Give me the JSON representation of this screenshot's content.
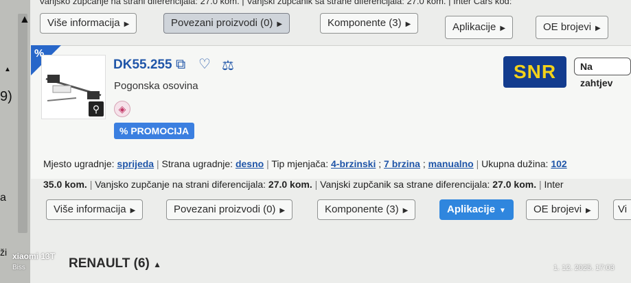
{
  "top_info": "Vanjsko zupčanje na strani diferencijala: 27.0 kom. | Vanjski zupčanik sa strane diferencijala: 27.0 kom. | Inter Cars kod:",
  "buttons_top": [
    "Više informacija",
    "Povezani proizvodi (0)",
    "Komponente (3)",
    "Aplikacije",
    "OE brojevi"
  ],
  "product": {
    "promo_corner": "%",
    "part_number": "DK55.255",
    "name": "Pogonska osovina",
    "promo_badge": "% PROMOCIJA",
    "brand": "SNR",
    "stock_status": "Na zahtjev"
  },
  "specs": {
    "line1": {
      "mjesto_label": "Mjesto ugradnje:",
      "mjesto_value": "sprijeda",
      "strana_label": "Strana ugradnje:",
      "strana_value": "desno",
      "tip_label": "Tip mjenjača:",
      "tip_v1": "4-brzinski",
      "tip_v2": "7 brzina",
      "tip_v3": "manualno",
      "duzina_label": "Ukupna dužina:",
      "duzina_value": "102"
    },
    "line2": {
      "kom": "35.0 kom.",
      "vz_label": "Vanjsko zupčanje na strani diferencijala:",
      "vz_value": "27.0 kom.",
      "vzk_label": "Vanjski zupčanik sa strane diferencijala:",
      "vzk_value": "27.0 kom.",
      "inter_label": "Inter"
    }
  },
  "buttons_bottom": [
    "Više informacija",
    "Povezani proizvodi (0)",
    "Komponente (3)",
    "Aplikacije",
    "OE brojevi",
    "Vi"
  ],
  "section": "RENAULT (6)",
  "left_fragments": {
    "a": "9)",
    "b": "a",
    "c": "ži"
  },
  "watermark": {
    "brand": "xiaomi 13T",
    "sub": "Biss",
    "timestamp": "1. 12. 2025. 17:03"
  },
  "colors": {
    "accent": "#2f86de",
    "brand_bg": "#133c8e",
    "brand_fg": "#f3d21a"
  }
}
